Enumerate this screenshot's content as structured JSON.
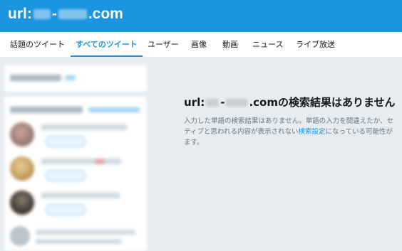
{
  "header": {
    "title_prefix": "url:",
    "title_dash": "-",
    "title_suffix": ".com"
  },
  "tabs": [
    {
      "label": "話題のツイート",
      "active": false
    },
    {
      "label": "すべてのツイート",
      "active": true
    },
    {
      "label": "ユーザー",
      "active": false
    },
    {
      "label": "画像",
      "active": false
    },
    {
      "label": "動画",
      "active": false
    },
    {
      "label": "ニュース",
      "active": false
    },
    {
      "label": "ライブ放送",
      "active": false
    }
  ],
  "empty_state": {
    "title_prefix": "url:",
    "title_dash": "-",
    "title_suffix": ".comの検索結果はありません",
    "desc_line1": "入力した単語の検索結果はありません。単語の入力を間違えたか、セ",
    "desc_line2_before": "ティブと思われる内容が表示されない",
    "desc_link": "検索設定",
    "desc_line2_after": "になっている可能性が",
    "desc_line3": "ます。"
  },
  "colors": {
    "brand": "#1b95e0",
    "background": "#e6ecf0",
    "text": "#14171a",
    "muted": "#657786"
  }
}
